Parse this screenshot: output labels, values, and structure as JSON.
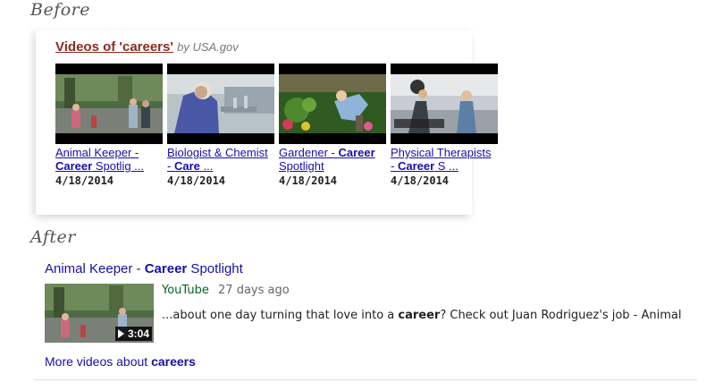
{
  "labels": {
    "before": "Before",
    "after": "After"
  },
  "before": {
    "header_title": "Videos of 'careers'",
    "header_source": "by USA.gov",
    "cards": [
      {
        "title_pre": "Animal Keeper - ",
        "title_bold": "Career",
        "title_post": " Spotlig ...",
        "date": "4/18/2014"
      },
      {
        "title_pre": "Biologist & Chemist - ",
        "title_bold": "Care",
        "title_post": " ...",
        "date": "4/18/2014"
      },
      {
        "title_pre": "Gardener - ",
        "title_bold": "Career",
        "title_post": " Spotlight",
        "date": "4/18/2014"
      },
      {
        "title_pre": "Physical Therapists - ",
        "title_bold": "Career",
        "title_post": " S ...",
        "date": "4/18/2014"
      }
    ]
  },
  "after": {
    "title_pre": "Animal Keeper - ",
    "title_bold": "Career",
    "title_post": " Spotlight",
    "duration": "3:04",
    "source": "YouTube",
    "age": "27 days ago",
    "snippet_pre": "...about one day turning that love into a ",
    "snippet_bold": "career",
    "snippet_post": "? Check out Juan Rodriguez's job - Animal",
    "more_pre": "More videos about ",
    "more_bold": "careers"
  },
  "colors": {
    "link": "#1a0dab",
    "header_title": "#8b2b1f",
    "source_green": "#006621"
  }
}
